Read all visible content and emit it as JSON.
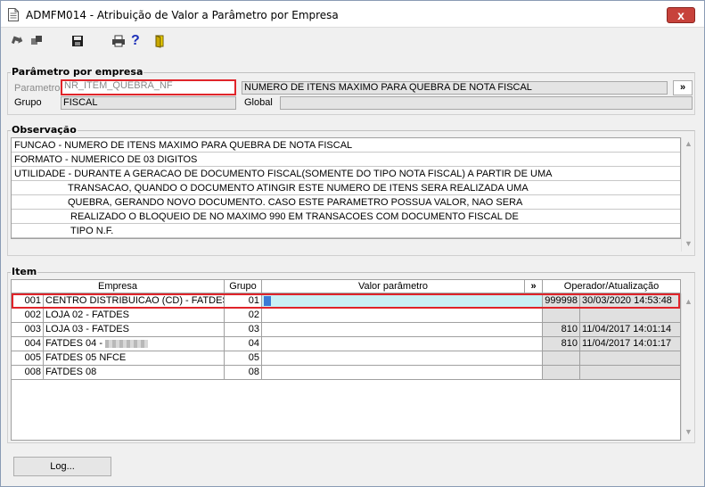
{
  "window": {
    "title": "ADMFM014 - Atribuição de Valor a Parâmetro por Empresa",
    "close_label": "x"
  },
  "toolbar": {
    "icons": [
      "exit-icon",
      "restore-icon",
      "save-icon",
      "print-icon",
      "help-icon",
      "door-icon"
    ],
    "help_glyph": "?"
  },
  "parametro_group": {
    "title": "Parâmetro por empresa",
    "parametro_label": "Parametro",
    "parametro_value": "NR_ITEM_QUEBRA_NF",
    "parametro_desc": "NUMERO DE ITENS MAXIMO PARA QUEBRA DE NOTA FISCAL",
    "expand_label": "»",
    "grupo_label": "Grupo",
    "grupo_value": "FISCAL",
    "global_label": "Global",
    "global_value": ""
  },
  "observacao": {
    "title": "Observação",
    "lines": [
      "FUNCAO - NUMERO DE ITENS MAXIMO PARA QUEBRA DE NOTA FISCAL",
      "FORMATO - NUMERICO DE 03 DIGITOS",
      "UTILIDADE - DURANTE A GERACAO DE DOCUMENTO FISCAL(SOMENTE DO TIPO NOTA FISCAL) A PARTIR DE UMA",
      "TRANSACAO, QUANDO O DOCUMENTO ATINGIR ESTE NUMERO DE ITENS SERA REALIZADA UMA",
      "QUEBRA, GERANDO NOVO DOCUMENTO. CASO ESTE PARAMETRO POSSUA VALOR, NAO SERA",
      "REALIZADO O BLOQUEIO DE NO MAXIMO 990 EM TRANSACOES COM DOCUMENTO FISCAL DE",
      "TIPO N.F."
    ]
  },
  "item": {
    "title": "Item",
    "columns": {
      "empresa": "Empresa",
      "grupo": "Grupo",
      "valor": "Valor parâmetro",
      "expand": "»",
      "operador": "Operador/Atualização"
    },
    "rows": [
      {
        "code": "001",
        "name": "CENTRO DISTRIBUICAO (CD) - FATDES",
        "grupo": "01",
        "valor": "",
        "operador": "999998",
        "atualizacao": "30/03/2020 14:53:48"
      },
      {
        "code": "002",
        "name": "LOJA 02 - FATDES",
        "grupo": "02",
        "valor": "",
        "operador": "",
        "atualizacao": ""
      },
      {
        "code": "003",
        "name": "LOJA 03 - FATDES",
        "grupo": "03",
        "valor": "",
        "operador": "810",
        "atualizacao": "11/04/2017 14:01:14"
      },
      {
        "code": "004",
        "name": "FATDES 04 -",
        "grupo": "04",
        "valor": "",
        "operador": "810",
        "atualizacao": "11/04/2017 14:01:17"
      },
      {
        "code": "005",
        "name": "FATDES 05 NFCE",
        "grupo": "05",
        "valor": "",
        "operador": "",
        "atualizacao": ""
      },
      {
        "code": "008",
        "name": "FATDES 08",
        "grupo": "08",
        "valor": "",
        "operador": "",
        "atualizacao": ""
      }
    ]
  },
  "footer": {
    "log_label": "Log..."
  }
}
